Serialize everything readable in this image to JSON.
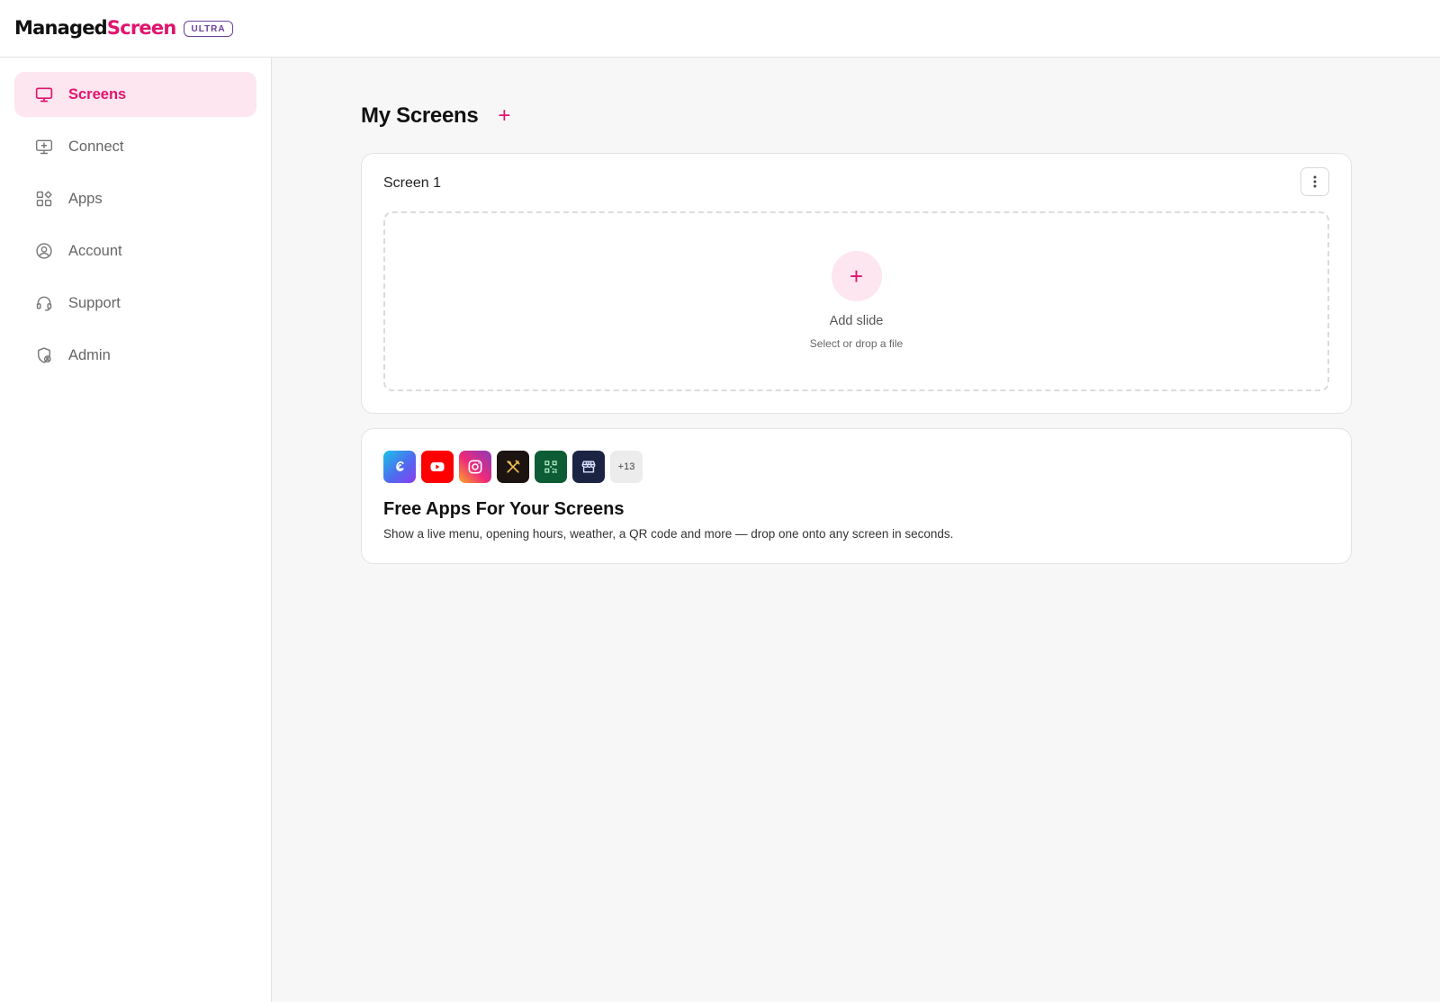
{
  "brand": {
    "name_part1": "Managed",
    "name_part2": "Screen",
    "badge": "ULTRA"
  },
  "sidebar": {
    "items": [
      {
        "label": "Screens",
        "icon": "monitor-icon",
        "active": true
      },
      {
        "label": "Connect",
        "icon": "monitor-plus-icon",
        "active": false
      },
      {
        "label": "Apps",
        "icon": "apps-grid-icon",
        "active": false
      },
      {
        "label": "Account",
        "icon": "user-circle-icon",
        "active": false
      },
      {
        "label": "Support",
        "icon": "headset-icon",
        "active": false
      },
      {
        "label": "Admin",
        "icon": "shield-user-icon",
        "active": false
      }
    ]
  },
  "main": {
    "title": "My Screens",
    "add_icon": "+",
    "screen": {
      "name": "Screen 1",
      "add_slide_icon": "+",
      "add_slide_label": "Add slide",
      "add_slide_hint": "Select or drop a file"
    },
    "apps_promo": {
      "icons": [
        "canva-icon",
        "youtube-icon",
        "instagram-icon",
        "restaurant-menu-icon",
        "qr-code-icon",
        "storefront-icon"
      ],
      "more_label": "+13",
      "title": "Free Apps For Your Screens",
      "description": "Show a live menu, opening hours, weather, a QR code and more — drop one onto any screen in seconds."
    }
  },
  "colors": {
    "accent": "#e0146e",
    "accent_light": "#fde6ef",
    "badge": "#6b3fa0"
  }
}
